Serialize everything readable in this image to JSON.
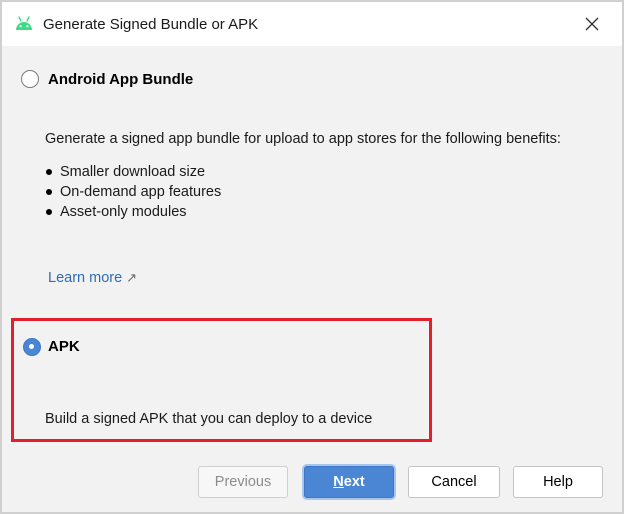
{
  "window": {
    "title": "Generate Signed Bundle or APK",
    "icon": "android-icon",
    "close_icon": "close-icon"
  },
  "options": {
    "bundle": {
      "label": "Android App Bundle",
      "selected": false,
      "description": "Generate a signed app bundle for upload to app stores for the following benefits:",
      "benefits": [
        "Smaller download size",
        "On-demand app features",
        "Asset-only modules"
      ],
      "learn_more": "Learn more",
      "learn_more_icon": "external-link-arrow-icon"
    },
    "apk": {
      "label": "APK",
      "selected": true,
      "description": "Build a signed APK that you can deploy to a device"
    }
  },
  "buttons": {
    "previous": "Previous",
    "next_mnemonic": "N",
    "next_rest": "ext",
    "cancel": "Cancel",
    "help": "Help"
  },
  "colors": {
    "accent": "#4a86d4",
    "highlight_box": "#e0202a",
    "link": "#2f6db3",
    "android_green": "#3ddc84"
  }
}
